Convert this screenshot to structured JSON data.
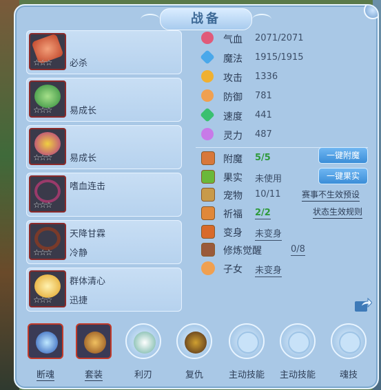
{
  "window": {
    "title": "战备"
  },
  "equipment": [
    {
      "line1": "",
      "line2": "必杀",
      "stars": "☆☆☆"
    },
    {
      "line1": "",
      "line2": "易成长",
      "stars": "☆☆☆"
    },
    {
      "line1": "",
      "line2": "易成长",
      "stars": "☆☆☆"
    },
    {
      "line1": "嗜血连击",
      "line2": "",
      "stars": "☆☆☆"
    },
    {
      "line1": "天降甘霖",
      "line2": "冷静",
      "stars": "☆☆☆"
    },
    {
      "line1": "群体清心",
      "line2": "迅捷",
      "stars": "☆☆☆"
    }
  ],
  "stats": [
    {
      "label": "气血",
      "value": "2071/2071",
      "icon": "heart-icon",
      "color": "#e05a7a"
    },
    {
      "label": "魔法",
      "value": "1915/1915",
      "icon": "mana-icon",
      "color": "#4aa8ea"
    },
    {
      "label": "攻击",
      "value": "1336",
      "icon": "attack-icon",
      "color": "#f0b030"
    },
    {
      "label": "防御",
      "value": "781",
      "icon": "defense-icon",
      "color": "#f0a050"
    },
    {
      "label": "速度",
      "value": "441",
      "icon": "speed-icon",
      "color": "#3ac070"
    },
    {
      "label": "灵力",
      "value": "487",
      "icon": "spirit-icon",
      "color": "#c87ae8"
    }
  ],
  "extras": [
    {
      "label": "附魔",
      "value": "5/5",
      "icon": "enchant-icon"
    },
    {
      "label": "果实",
      "value": "未使用",
      "icon": "fruit-icon"
    },
    {
      "label": "宠物",
      "value": "10/11",
      "icon": "pet-icon"
    },
    {
      "label": "祈福",
      "value": "2/2",
      "icon": "blessing-icon"
    },
    {
      "label": "变身",
      "value": "未变身",
      "icon": "transform-icon"
    },
    {
      "label": "修炼觉醒",
      "value": "0/8",
      "icon": "cultivation-icon"
    },
    {
      "label": "子女",
      "value": "未变身",
      "icon": "children-icon"
    }
  ],
  "buttons": {
    "enchant_all": "一键附魔",
    "fruit_all": "一键果实",
    "event_preset": "赛事不生效预设",
    "status_rules": "状态生效规则"
  },
  "slots": [
    {
      "label": "断魂"
    },
    {
      "label": "套装"
    },
    {
      "label": "利刃"
    },
    {
      "label": "复仇"
    },
    {
      "label": "主动技能"
    },
    {
      "label": "主动技能"
    },
    {
      "label": "魂技"
    }
  ]
}
